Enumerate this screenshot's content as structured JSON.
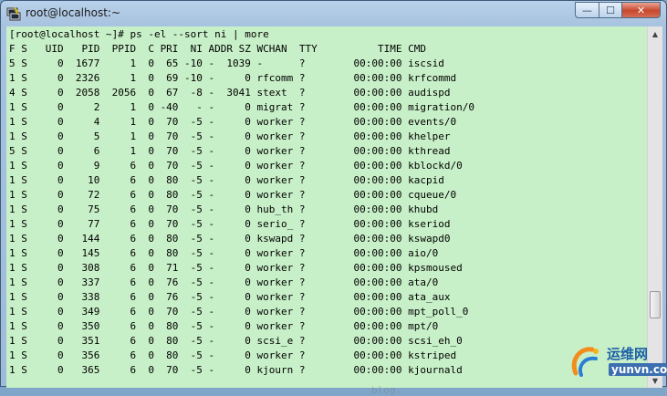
{
  "window": {
    "title": "root@localhost:~",
    "controls": {
      "minimize": "—",
      "maximize": "☐",
      "close": "✕"
    },
    "icons": {
      "app": "putty-icon"
    }
  },
  "terminal": {
    "lines": [
      "[root@localhost ~]# ps -el --sort ni | more",
      "F S   UID   PID  PPID  C PRI  NI ADDR SZ WCHAN  TTY          TIME CMD",
      "5 S     0  1677     1  0  65 -10 -  1039 -      ?        00:00:00 iscsid",
      "1 S     0  2326     1  0  69 -10 -     0 rfcomm ?        00:00:00 krfcommd",
      "4 S     0  2058  2056  0  67  -8 -  3041 stext  ?        00:00:00 audispd",
      "1 S     0     2     1  0 -40   - -     0 migrat ?        00:00:00 migration/0",
      "1 S     0     4     1  0  70  -5 -     0 worker ?        00:00:00 events/0",
      "1 S     0     5     1  0  70  -5 -     0 worker ?        00:00:00 khelper",
      "5 S     0     6     1  0  70  -5 -     0 worker ?        00:00:00 kthread",
      "1 S     0     9     6  0  70  -5 -     0 worker ?        00:00:00 kblockd/0",
      "1 S     0    10     6  0  80  -5 -     0 worker ?        00:00:00 kacpid",
      "1 S     0    72     6  0  80  -5 -     0 worker ?        00:00:00 cqueue/0",
      "1 S     0    75     6  0  70  -5 -     0 hub_th ?        00:00:00 khubd",
      "1 S     0    77     6  0  70  -5 -     0 serio_ ?        00:00:00 kseriod",
      "1 S     0   144     6  0  80  -5 -     0 kswapd ?        00:00:00 kswapd0",
      "1 S     0   145     6  0  80  -5 -     0 worker ?        00:00:00 aio/0",
      "1 S     0   308     6  0  71  -5 -     0 worker ?        00:00:00 kpsmoused",
      "1 S     0   337     6  0  76  -5 -     0 worker ?        00:00:00 ata/0",
      "1 S     0   338     6  0  76  -5 -     0 worker ?        00:00:00 ata_aux",
      "1 S     0   349     6  0  70  -5 -     0 worker ?        00:00:00 mpt_poll_0",
      "1 S     0   350     6  0  80  -5 -     0 worker ?        00:00:00 mpt/0",
      "1 S     0   351     6  0  80  -5 -     0 scsi_e ?        00:00:00 scsi_eh_0",
      "1 S     0   356     6  0  80  -5 -     0 worker ?        00:00:00 kstriped",
      "1 S     0   365     6  0  70  -5 -     0 kjourn ?        00:00:00 kjournald"
    ],
    "scroll_position": 0.82
  },
  "watermark": "blog.",
  "logo": {
    "name": "运维网",
    "sub": "yunvn.com"
  },
  "colors": {
    "terminal_bg": "#c8f0c8",
    "titlebar": "#b9d1ea",
    "close": "#c8462c"
  }
}
